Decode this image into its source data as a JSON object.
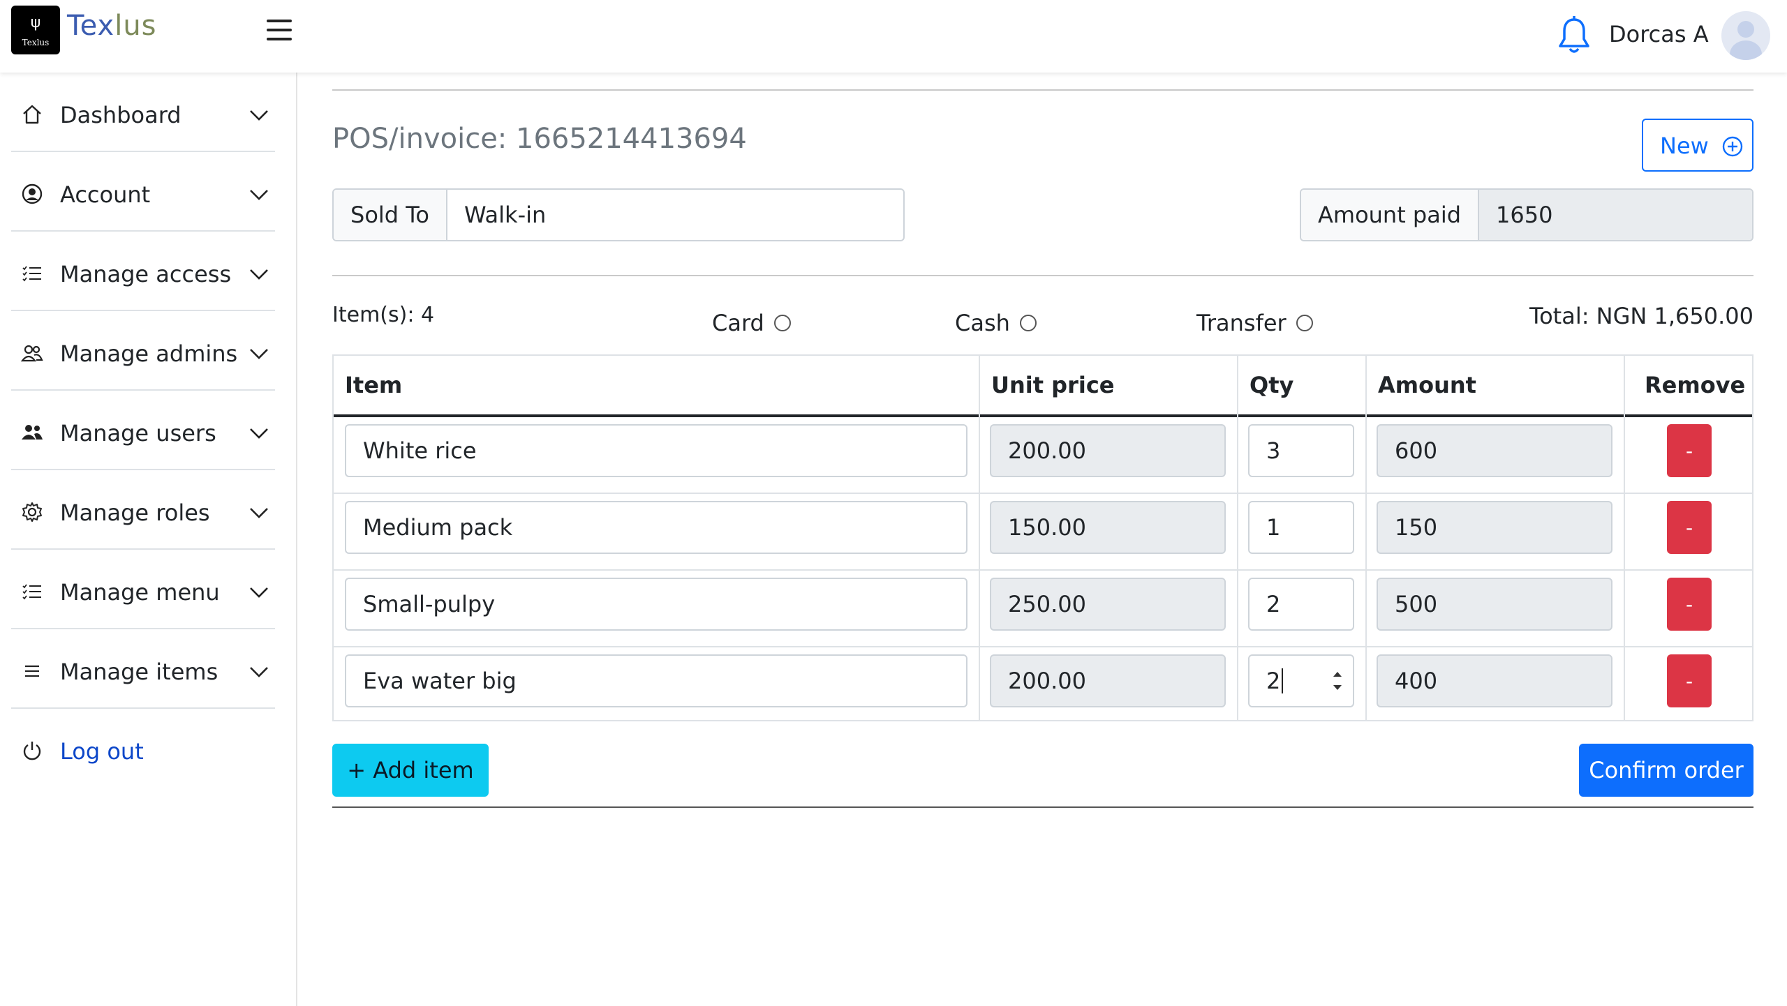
{
  "app": {
    "logo_small": "Texlus",
    "brand_prefix": "Tex",
    "brand_suffix": "lus",
    "user_name": "Dorcas A"
  },
  "sidebar": {
    "items": [
      {
        "label": "Dashboard",
        "icon": "home-icon"
      },
      {
        "label": "Account",
        "icon": "user-circle-icon"
      },
      {
        "label": "Manage access",
        "icon": "list-icon"
      },
      {
        "label": "Manage admins",
        "icon": "people-icon"
      },
      {
        "label": "Manage users",
        "icon": "people-fill-icon"
      },
      {
        "label": "Manage roles",
        "icon": "gear-icon"
      },
      {
        "label": "Manage menu",
        "icon": "list-icon"
      },
      {
        "label": "Manage items",
        "icon": "menu-lines-icon"
      }
    ],
    "logout_label": "Log out"
  },
  "invoice": {
    "title": "POS/invoice: 1665214413694",
    "new_button": "New",
    "sold_to_label": "Sold To",
    "sold_to_value": "Walk-in",
    "amount_paid_label": "Amount paid",
    "amount_paid_value": "1650",
    "items_count": "Item(s): 4",
    "payment_methods": [
      "Card",
      "Cash",
      "Transfer"
    ],
    "total": "Total: NGN 1,650.00",
    "columns": [
      "Item",
      "Unit price",
      "Qty",
      "Amount",
      "Remove"
    ],
    "rows": [
      {
        "item": "White rice",
        "unit_price": "200.00",
        "qty": "3",
        "amount": "600",
        "remove": "-"
      },
      {
        "item": "Medium pack",
        "unit_price": "150.00",
        "qty": "1",
        "amount": "150",
        "remove": "-"
      },
      {
        "item": "Small-pulpy",
        "unit_price": "250.00",
        "qty": "2",
        "amount": "500",
        "remove": "-"
      },
      {
        "item": "Eva water big",
        "unit_price": "200.00",
        "qty": "2",
        "amount": "400",
        "remove": "-"
      }
    ],
    "add_item_button": "+  Add item",
    "confirm_button": "Confirm order"
  },
  "colors": {
    "primary": "#0d6efd",
    "info": "#0dcaf0",
    "danger": "#dc3545",
    "link": "#0d47c9"
  }
}
